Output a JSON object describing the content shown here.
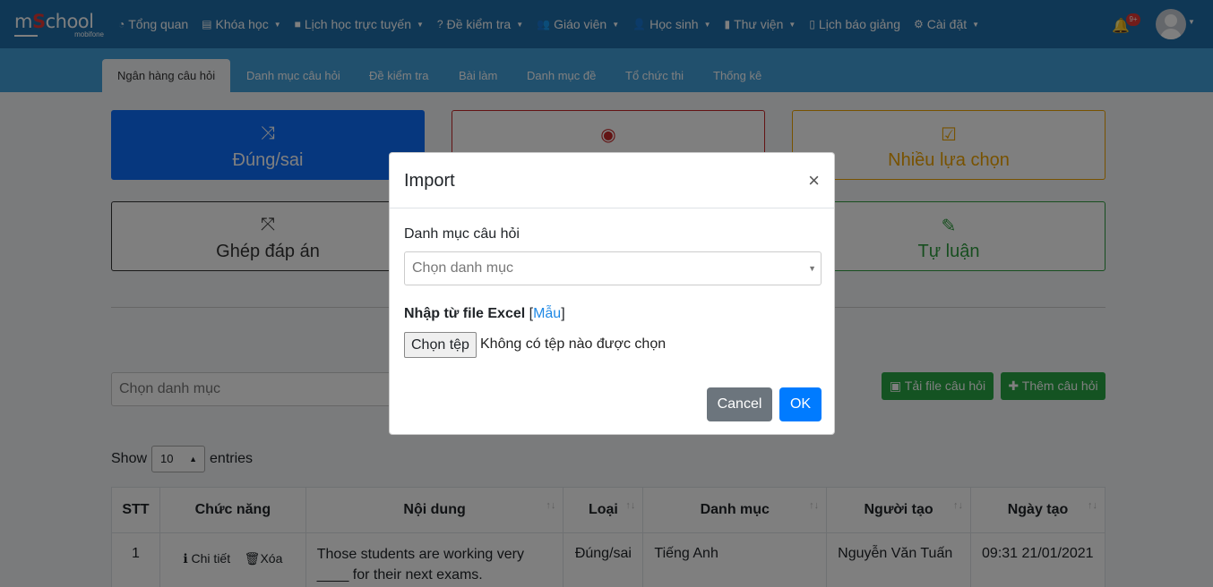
{
  "brand": {
    "logo_main_a": "m",
    "logo_main_s": "S",
    "logo_main_b": "chool",
    "logo_sub": "mobifone"
  },
  "topnav": {
    "items": [
      {
        "icon": "dashboard-icon",
        "glyph": "◔",
        "label": "Tổng quan",
        "caret": false
      },
      {
        "icon": "book-icon",
        "glyph": "▤",
        "label": "Khóa học",
        "caret": true
      },
      {
        "icon": "video-icon",
        "glyph": "■",
        "label": "Lịch học trực tuyến",
        "caret": true
      },
      {
        "icon": "question-icon",
        "glyph": "?",
        "label": "Đề kiểm tra",
        "caret": true
      },
      {
        "icon": "users-icon",
        "glyph": "👥",
        "label": "Giáo viên",
        "caret": true
      },
      {
        "icon": "user-icon",
        "glyph": "👤",
        "label": "Học sinh",
        "caret": true
      },
      {
        "icon": "library-icon",
        "glyph": "▮",
        "label": "Thư viện",
        "caret": true
      },
      {
        "icon": "clipboard-icon",
        "glyph": "▯",
        "label": "Lịch báo giảng",
        "caret": false
      },
      {
        "icon": "cogs-icon",
        "glyph": "⚙",
        "label": "Cài đặt",
        "caret": true
      }
    ],
    "notification_count": "9+"
  },
  "subnav": {
    "tabs": [
      "Ngân hàng câu hỏi",
      "Danh mục câu hỏi",
      "Đề kiểm tra",
      "Bài làm",
      "Danh mục đề",
      "Tổ chức thi",
      "Thống kê"
    ]
  },
  "cards": {
    "true_false": "Đúng/sai",
    "multiple_choice": "Nhiều lựa chọn",
    "matching": "Ghép đáp án",
    "essay": "Tự luận"
  },
  "filters": {
    "category_placeholder": "Chọn danh mục",
    "download_label": "Tải file câu hỏi",
    "add_label": "Thêm câu hỏi"
  },
  "entries": {
    "show": "Show",
    "value": "10",
    "suffix": "entries"
  },
  "table": {
    "headers": [
      "STT",
      "Chức năng",
      "Nội dung",
      "Loại",
      "Danh mục",
      "Người tạo",
      "Ngày tạo"
    ],
    "rows": [
      {
        "stt": "1",
        "detail_label": "Chi tiết",
        "delete_label": "Xóa",
        "content": "Those students are working very ____ for their next exams.",
        "type": "Đúng/sai",
        "category": "Tiếng Anh",
        "creator": "Nguyễn Văn Tuấn",
        "created": "09:31 21/01/2021"
      }
    ]
  },
  "modal": {
    "title": "Import",
    "category_label": "Danh mục câu hỏi",
    "category_placeholder": "Chọn danh mục",
    "excel_label": "Nhập từ file Excel",
    "template_link": "Mẫu",
    "file_button": "Chọn tệp",
    "file_status": "Không có tệp nào được chọn",
    "cancel": "Cancel",
    "ok": "OK"
  },
  "colors": {
    "nav": "#1f6fab",
    "subnav": "#42a0db",
    "true_false": "#0d6efd",
    "single_choice": "#c62828",
    "multiple_choice": "#f0a500",
    "matching": "#333333",
    "essay": "#2e9d3e"
  }
}
